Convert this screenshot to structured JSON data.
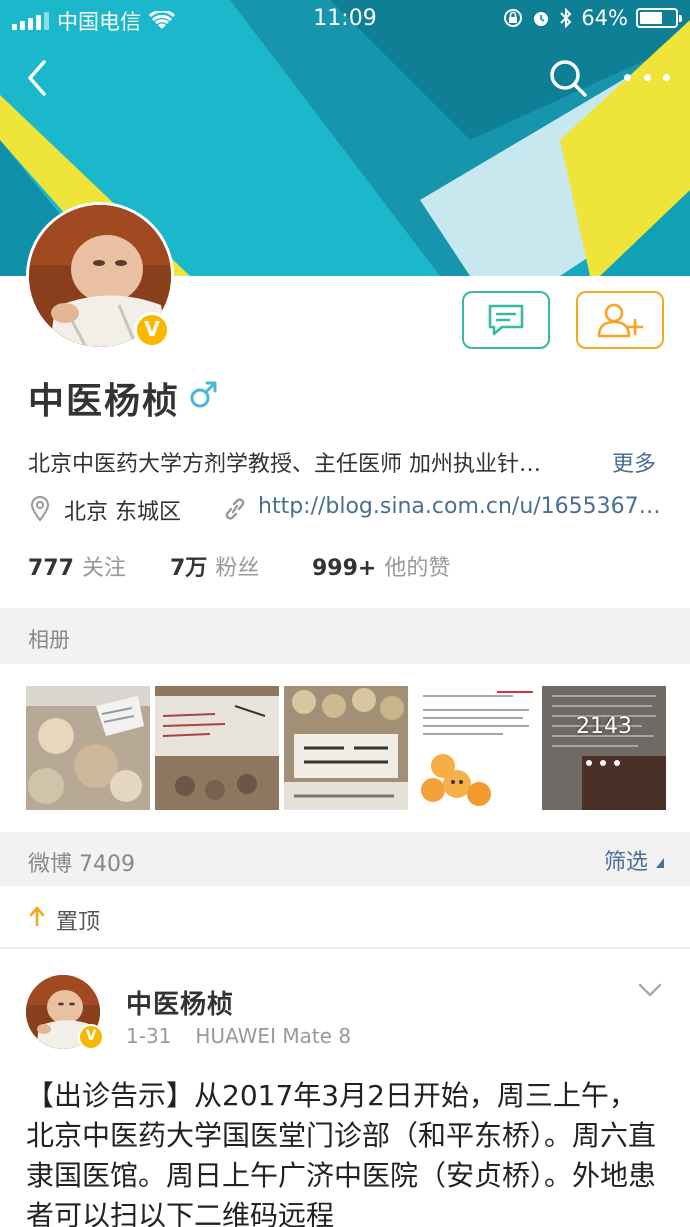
{
  "status_bar": {
    "carrier": "中国电信",
    "time": "11:09",
    "battery": "64%",
    "battery_level": 0.64
  },
  "header": {
    "colors": {
      "teal": "#19b5c8",
      "dark_teal": "#1592a8",
      "light": "#bfe6ee",
      "yellow": "#f0e030",
      "white": "#ffffff"
    }
  },
  "profile": {
    "name": "中医杨桢",
    "gender_icon": "male-icon",
    "verified_badge": "V",
    "bio": "北京中医药大学方剂学教授、主任医师 加州执业针…",
    "bio_more": "更多",
    "location": "北京 东城区",
    "link": "http://blog.sina.com.cn/u/1655367…",
    "stats": [
      {
        "value": "777",
        "label": "关注"
      },
      {
        "value": "7万",
        "label": "粉丝"
      },
      {
        "value": "999+",
        "label": "他的赞"
      }
    ]
  },
  "album": {
    "title": "相册",
    "last_count": "2143"
  },
  "feed": {
    "title": "微博 7409",
    "filter": "筛选",
    "pinned": "置顶"
  },
  "post": {
    "author": "中医杨桢",
    "date": "1-31",
    "device": "HUAWEI Mate 8",
    "text": "【出诊告示】从2017年3月2日开始，周三上午，北京中医药大学国医堂门诊部（和平东桥）。周六直隶国医馆。周日上午广济中医院（安贞桥）。外地患者可以扫以下二维码远程"
  },
  "colors": {
    "accent_link": "#4a6e96",
    "message_button": "#37b9a6",
    "follow_button": "#f5a623",
    "verified": "#f9b800"
  }
}
